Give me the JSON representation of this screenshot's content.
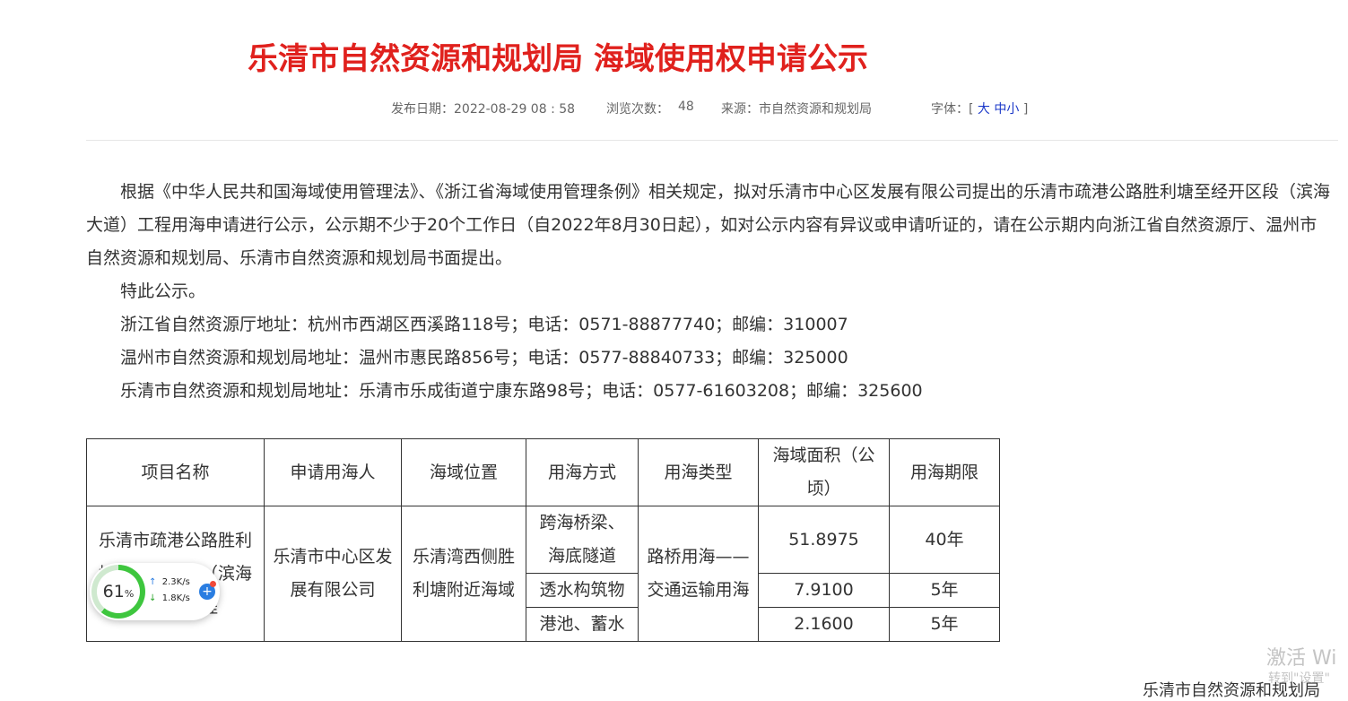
{
  "article": {
    "title": "乐清市自然资源和规划局 海域使用权申请公示",
    "meta": {
      "date": "发布日期：2022-08-29 08 : 58",
      "views_label": "浏览次数：",
      "views": "48",
      "source": "来源：市自然资源和规划局",
      "font_label": "字体：[",
      "font_large": "大",
      "font_medium": "中",
      "font_small": "小",
      "font_close": "]"
    },
    "paragraphs": [
      "根据《中华人民共和国海域使用管理法》、《浙江省海域使用管理条例》相关规定，拟对乐清市中心区发展有限公司提出的乐清市疏港公路胜利塘至经开区段（滨海大道）工程用海申请进行公示，公示期不少于20个工作日（自2022年8月30日起），如对公示内容有异议或申请听证的，请在公示期内向浙江省自然资源厅、温州市自然资源和规划局、乐清市自然资源和规划局书面提出。",
      "特此公示。",
      "浙江省自然资源厅地址：杭州市西湖区西溪路118号；电话：0571-88877740；邮编：310007",
      "温州市自然资源和规划局地址：温州市惠民路856号；电话：0577-88840733；邮编：325000",
      "乐清市自然资源和规划局地址：乐清市乐成街道宁康东路98号；电话：0577-61603208；邮编：325600"
    ]
  },
  "table": {
    "headers": [
      "项目名称",
      "申请用海人",
      "海域位置",
      "用海方式",
      "用海类型",
      "海域面积（公顷）",
      "用海期限"
    ],
    "project": "乐清市疏港公路胜利塘至经开区段（滨海大道）工程",
    "applicant": "乐清市中心区发展有限公司",
    "location": "乐清湾西侧胜利塘附近海域",
    "sea_type": "路桥用海——交通运输用海",
    "rows": [
      {
        "method": "跨海桥梁、海底隧道",
        "area": "51.8975",
        "term": "40年"
      },
      {
        "method": "透水构筑物",
        "area": "7.9100",
        "term": "5年"
      },
      {
        "method": "港池、蓄水",
        "area": "2.1600",
        "term": "5年"
      }
    ]
  },
  "widget": {
    "percent": "61",
    "percent_unit": "%",
    "percent_value": 0.61,
    "upload": "2.3K/s",
    "download": "1.8K/s",
    "up_arrow": "↑",
    "down_arrow": "↓",
    "boost": "+",
    "colors": {
      "ring": "#3ec63e",
      "boost": "#2a7de1"
    }
  },
  "overlay": {
    "watermark_line1": "激活 Wi",
    "watermark_line2": "转到\"设置\"",
    "clipped_text": "乐清市自然资源和规划局"
  }
}
